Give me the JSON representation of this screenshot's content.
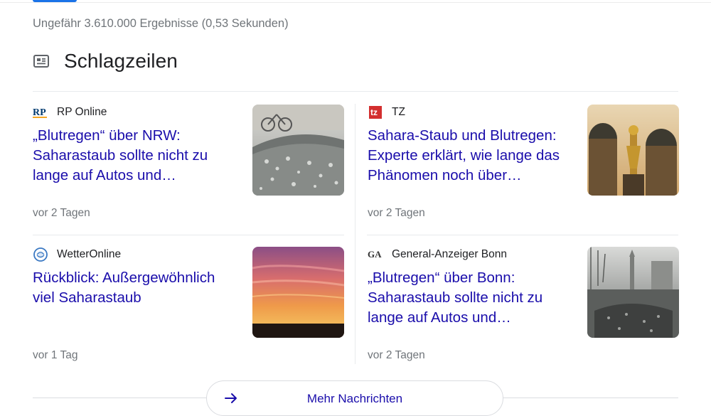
{
  "stats": {
    "text": "Ungefähr 3.610.000 Ergebnisse (0,53 Sekunden)"
  },
  "section": {
    "title": "Schlagzeilen",
    "icon": "newspaper-icon"
  },
  "cards": [
    {
      "source": "RP Online",
      "logo_text": "RP",
      "title": "„Blutregen“ über NRW: Saharastaub sollte nicht zu lange auf Autos und…",
      "time": "vor 2 Tagen",
      "thumb": "car-roof-with-dust-photo"
    },
    {
      "source": "TZ",
      "logo_text": "tz",
      "title": "Sahara-Staub und Blutregen: Experte erklärt, wie lange das Phänomen noch über…",
      "time": "vor 2 Tagen",
      "thumb": "munich-frauenkirche-photo"
    },
    {
      "source": "WetterOnline",
      "title": "Rückblick: Außergewöhnlich viel Saharastaub",
      "time": "vor 1 Tag",
      "thumb": "red-sunset-sky-photo"
    },
    {
      "source": "General-Anzeiger Bonn",
      "logo_text": "GA",
      "title": "„Blutregen“ über Bonn: Saharastaub sollte nicht zu lange auf Autos und…",
      "time": "vor 2 Tagen",
      "thumb": "bonn-street-car-photo"
    }
  ],
  "more": {
    "label": "Mehr Nachrichten",
    "icon": "arrow-right-icon"
  },
  "colors": {
    "link": "#1a0dab",
    "meta": "#70757a",
    "accent": "#1a73e8",
    "divider": "#e8eaed"
  }
}
